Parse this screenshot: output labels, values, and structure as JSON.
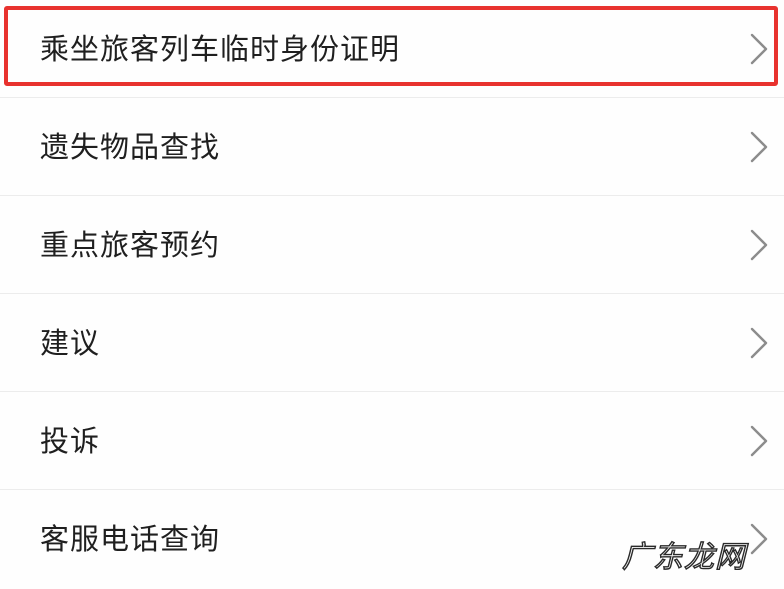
{
  "menu": {
    "items": [
      {
        "label": "乘坐旅客列车临时身份证明",
        "highlighted": true
      },
      {
        "label": "遗失物品查找",
        "highlighted": false
      },
      {
        "label": "重点旅客预约",
        "highlighted": false
      },
      {
        "label": "建议",
        "highlighted": false
      },
      {
        "label": "投诉",
        "highlighted": false
      },
      {
        "label": "客服电话查询",
        "highlighted": false
      }
    ],
    "chevron_icon": "chevron-right-icon"
  },
  "highlight": {
    "color": "#e8322e"
  },
  "watermark": {
    "text": "广东龙网"
  }
}
